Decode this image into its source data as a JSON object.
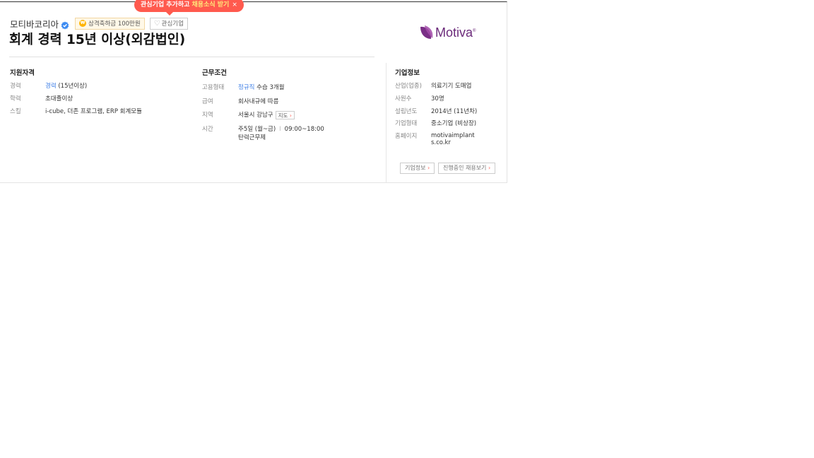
{
  "tooltip": {
    "text1": "관심기업 추가하고 ",
    "highlight": "채용소식 받기",
    "close": "×"
  },
  "company": {
    "name": "모티바코리아",
    "badge": "삼격축하금 100만원",
    "interest_label": "관심기업",
    "logo_text": "Motiva",
    "logo_mark": "®"
  },
  "job": {
    "title": "회계 경력 15년 이상(외감법인)"
  },
  "qualifications": {
    "title": "지원자격",
    "rows": [
      {
        "key": "경력",
        "value_link": "경력",
        "value": " (15년이상)"
      },
      {
        "key": "학력",
        "value_link": "초대졸이상",
        "value": ""
      },
      {
        "key": "스킬",
        "value_link": "",
        "value": "i-cube, 더존 프로그램, ERP 회계모듈"
      }
    ]
  },
  "conditions": {
    "title": "근무조건",
    "employment": {
      "key": "고용형태",
      "link": "정규직",
      "value": " 수습 3개월"
    },
    "salary": {
      "key": "급여",
      "value": "회사내규에 따름"
    },
    "location": {
      "key": "지역",
      "value": "서울시 강남구",
      "map": "지도"
    },
    "hours": {
      "key": "시간",
      "days": "주5일 (월~금)",
      "sep": "I",
      "time": "09:00~18:00",
      "flex": "탄력근무제"
    }
  },
  "company_info": {
    "title": "기업정보",
    "rows": [
      {
        "key": "산업(업종)",
        "value": "의료기기 도매업"
      },
      {
        "key": "사원수",
        "value": "30명"
      },
      {
        "key": "설립년도",
        "value": "2014년 (11년차)"
      },
      {
        "key": "기업형태",
        "value": "중소기업 (비상장)"
      },
      {
        "key": "홈페이지",
        "value": "motivaimplants.co.kr"
      }
    ],
    "info_button": "기업정보",
    "jobs_button": "진행중인 채용보기",
    "arrow": "›"
  },
  "colors": {
    "accent": "#ff5a4e",
    "link": "#3d7ee6",
    "brand": "#6b2a7a"
  }
}
